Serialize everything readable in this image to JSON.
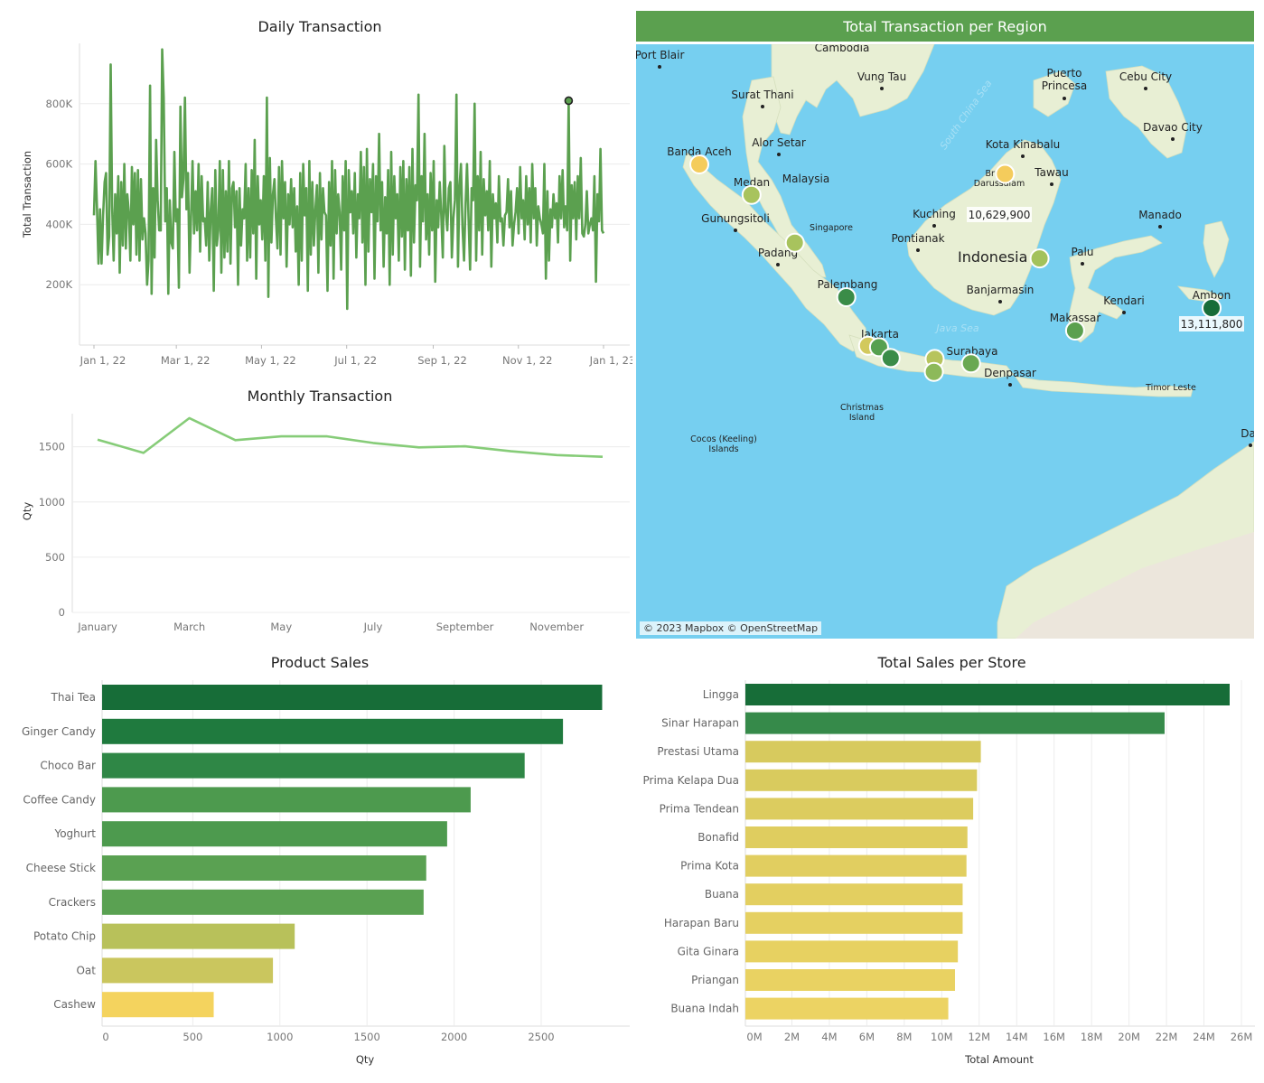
{
  "daily": {
    "title": "Daily Transaction",
    "ylabel": "Total Transaction",
    "xticks": [
      "Jan 1, 22",
      "Mar 1, 22",
      "May 1, 22",
      "Jul 1, 22",
      "Sep 1, 22",
      "Nov 1, 22",
      "Jan 1, 23"
    ],
    "yticks": [
      "200K",
      "400K",
      "600K",
      "800K"
    ]
  },
  "monthly": {
    "title": "Monthly Transaction",
    "ylabel": "Qty",
    "xticks": [
      "January",
      "March",
      "May",
      "July",
      "September",
      "November"
    ],
    "yticks": [
      "0",
      "500",
      "1000",
      "1500"
    ]
  },
  "map": {
    "title": "Total Transaction per Region",
    "attribution": "© 2023 Mapbox © OpenStreetMap",
    "country_label": "Indonesia",
    "places": [
      "Cambodia",
      "Port Blair",
      "Vung Tau",
      "Surat Thani",
      "Puerto Princesa",
      "Cebu City",
      "Davao City",
      "Alor Setar",
      "Banda Aceh",
      "Medan",
      "Malaysia",
      "Kota Kinabalu",
      "Brunei Darussalam",
      "Tawau",
      "Kuching",
      "Gunungsitoli",
      "Singapore",
      "Manado",
      "Padang",
      "Pontianak",
      "Palu",
      "Palembang",
      "Banjarmasin",
      "Kendari",
      "Ambon",
      "Makassar",
      "Jakarta",
      "Surabaya",
      "Denpasar",
      "Christmas Island",
      "Cocos (Keeling) Islands",
      "Timor Leste",
      "Dar",
      "South China Sea",
      "Java Sea"
    ],
    "value_labels": [
      "10,629,900",
      "13,111,800"
    ]
  },
  "product": {
    "title": "Product Sales",
    "xlabel": "Qty",
    "xticks": [
      "0",
      "500",
      "1000",
      "1500",
      "2000",
      "2500"
    ]
  },
  "store": {
    "title": "Total Sales per Store",
    "xlabel": "Total Amount",
    "xticks": [
      "0M",
      "2M",
      "4M",
      "6M",
      "8M",
      "10M",
      "12M",
      "14M",
      "16M",
      "18M",
      "20M",
      "22M",
      "24M",
      "26M"
    ]
  },
  "colors": {
    "dark_green": "#176d38",
    "green": "#5ba04f",
    "light_green": "#86cc78",
    "yellow": "#f4d35e",
    "water": "#76cff0",
    "land": "#e8efd4"
  },
  "chart_data": [
    {
      "type": "line",
      "title": "Daily Transaction",
      "ylabel": "Total Transaction",
      "x_range": [
        "2022-01-01",
        "2022-12-31"
      ],
      "ylim": [
        0,
        1000000
      ],
      "series": [
        {
          "values": [
            430000,
            610000,
            450000,
            270000,
            450000,
            270000,
            430000,
            540000,
            570000,
            300000,
            360000,
            930000,
            460000,
            280000,
            500000,
            370000,
            560000,
            240000,
            540000,
            330000,
            600000,
            320000,
            500000,
            440000,
            280000,
            590000,
            400000,
            570000,
            300000,
            580000,
            280000,
            550000,
            350000,
            420000,
            370000,
            200000,
            280000,
            860000,
            170000,
            520000,
            290000,
            680000,
            480000,
            380000,
            380000,
            980000,
            820000,
            410000,
            520000,
            170000,
            480000,
            340000,
            320000,
            640000,
            410000,
            450000,
            190000,
            790000,
            490000,
            550000,
            820000,
            450000,
            570000,
            240000,
            420000,
            610000,
            370000,
            510000,
            380000,
            600000,
            310000,
            560000,
            410000,
            420000,
            330000,
            540000,
            280000,
            450000,
            520000,
            180000,
            580000,
            330000,
            380000,
            610000,
            240000,
            580000,
            290000,
            510000,
            310000,
            610000,
            270000,
            520000,
            540000,
            390000,
            510000,
            200000,
            520000,
            330000,
            450000,
            420000,
            600000,
            280000,
            520000,
            290000,
            580000,
            370000,
            680000,
            220000,
            560000,
            400000,
            480000,
            350000,
            560000,
            280000,
            820000,
            160000,
            620000,
            340000,
            500000,
            550000,
            420000,
            320000,
            590000,
            300000,
            610000,
            420000,
            540000,
            260000,
            500000,
            400000,
            550000,
            390000,
            520000,
            310000,
            460000,
            200000,
            570000,
            280000,
            600000,
            430000,
            520000,
            180000,
            610000,
            300000,
            540000,
            330000,
            450000,
            530000,
            240000,
            570000,
            350000,
            520000,
            440000,
            430000,
            180000,
            540000,
            330000,
            610000,
            220000,
            580000,
            370000,
            500000,
            440000,
            250000,
            560000,
            380000,
            610000,
            120000,
            580000,
            440000,
            510000,
            370000,
            570000,
            290000,
            500000,
            420000,
            640000,
            340000,
            590000,
            200000,
            650000,
            310000,
            550000,
            440000,
            600000,
            220000,
            560000,
            410000,
            700000,
            380000,
            540000,
            260000,
            490000,
            370000,
            580000,
            200000,
            640000,
            300000,
            560000,
            420000,
            500000,
            280000,
            590000,
            360000,
            610000,
            250000,
            550000,
            380000,
            590000,
            230000,
            650000,
            340000,
            530000,
            480000,
            830000,
            260000,
            560000,
            410000,
            700000,
            350000,
            500000,
            300000,
            570000,
            380000,
            610000,
            210000,
            480000,
            390000,
            540000,
            430000,
            290000,
            660000,
            440000,
            380000,
            520000,
            540000,
            290000,
            420000,
            480000,
            830000,
            260000,
            520000,
            600000,
            390000,
            280000,
            470000,
            600000,
            420000,
            250000,
            520000,
            480000,
            800000,
            280000,
            560000,
            380000,
            640000,
            300000,
            550000,
            430000,
            510000,
            380000,
            610000,
            260000,
            500000,
            420000,
            470000,
            340000,
            560000,
            410000,
            420000,
            330000,
            430000,
            440000,
            550000,
            390000,
            510000,
            330000,
            400000,
            440000,
            520000,
            370000,
            590000,
            420000,
            480000,
            350000,
            560000,
            400000,
            520000,
            340000,
            600000,
            420000,
            520000,
            330000,
            460000,
            420000,
            400000,
            370000,
            600000,
            220000,
            510000,
            280000,
            450000,
            390000,
            500000,
            420000,
            470000,
            340000,
            560000,
            420000,
            580000,
            390000,
            460000,
            380000,
            810000,
            280000,
            530000,
            420000,
            540000,
            350000,
            560000,
            420000,
            620000,
            370000,
            360000,
            400000,
            510000,
            370000,
            400000,
            420000,
            380000,
            560000,
            210000,
            500000,
            410000,
            650000,
            380000,
            370000
          ]
        }
      ]
    },
    {
      "type": "line",
      "title": "Monthly Transaction",
      "ylabel": "Qty",
      "categories": [
        "January",
        "February",
        "March",
        "April",
        "May",
        "June",
        "July",
        "August",
        "September",
        "October",
        "November",
        "December"
      ],
      "ylim": [
        0,
        1800
      ],
      "series": [
        {
          "values": [
            1565,
            1445,
            1760,
            1560,
            1595,
            1595,
            1535,
            1495,
            1505,
            1460,
            1425,
            1410
          ]
        }
      ]
    },
    {
      "type": "bar",
      "orientation": "horizontal",
      "title": "Product Sales",
      "xlabel": "Qty",
      "categories": [
        "Thai Tea",
        "Ginger Candy",
        "Choco Bar",
        "Coffee Candy",
        "Yoghurt",
        "Cheese Stick",
        "Crackers",
        "Potato Chip",
        "Oat",
        "Cashew"
      ],
      "values": [
        2850,
        2625,
        2405,
        2095,
        1960,
        1840,
        1825,
        1085,
        960,
        620
      ],
      "colors": [
        "#176d38",
        "#1f7a3e",
        "#2f8746",
        "#4d9a4e",
        "#4d9a4e",
        "#5aa152",
        "#5aa152",
        "#b8c15a",
        "#cac65e",
        "#f4d35e"
      ],
      "xlim": [
        0,
        3000
      ]
    },
    {
      "type": "bar",
      "orientation": "horizontal",
      "title": "Total Sales per Store",
      "xlabel": "Total Amount",
      "categories": [
        "Lingga",
        "Sinar Harapan",
        "Prestasi Utama",
        "Prima Kelapa Dua",
        "Prima Tendean",
        "Bonafid",
        "Prima Kota",
        "Buana",
        "Harapan Baru",
        "Gita Ginara",
        "Priangan",
        "Buana Indah"
      ],
      "values": [
        25300000,
        21900000,
        12300000,
        12100000,
        11900000,
        11600000,
        11550000,
        11350000,
        11350000,
        11100000,
        10950000,
        10600000
      ],
      "colors": [
        "#176d38",
        "#368a4a",
        "#d7ca5e",
        "#d9cb5e",
        "#dccc5f",
        "#dfcd5f",
        "#e1ce60",
        "#e3cf60",
        "#e5d061",
        "#e7d161",
        "#e9d262",
        "#ecd363"
      ],
      "xlim": [
        0,
        26500000
      ]
    },
    {
      "type": "scatter",
      "title": "Total Transaction per Region",
      "kind": "map",
      "points": [
        {
          "region": "Banda Aceh",
          "lon": 95.32,
          "lat": 5.55,
          "value": 10700000,
          "color": "#f4cc5c"
        },
        {
          "region": "Medan",
          "lon": 98.67,
          "lat": 3.59,
          "value": 11900000,
          "color": "#a8c35d"
        },
        {
          "region": "Pekanbaru",
          "lon": 101.45,
          "lat": 0.51,
          "value": 11800000,
          "color": "#a8c35d"
        },
        {
          "region": "Brunei Darussalam",
          "lon": 114.94,
          "lat": 4.94,
          "value": 10629900,
          "color": "#f4cc5c"
        },
        {
          "region": "Samarinda",
          "lon": 117.15,
          "lat": -0.5,
          "value": 11900000,
          "color": "#a3c25b"
        },
        {
          "region": "Palembang",
          "lon": 104.75,
          "lat": -2.99,
          "value": 12500000,
          "color": "#3a8c48"
        },
        {
          "region": "Ambon",
          "lon": 128.19,
          "lat": -3.69,
          "value": 13111800,
          "color": "#176d38"
        },
        {
          "region": "Makassar",
          "lon": 119.43,
          "lat": -5.14,
          "value": 12200000,
          "color": "#5ba04f"
        },
        {
          "region": "Serang",
          "lon": 106.15,
          "lat": -6.12,
          "value": 11300000,
          "color": "#d2c95d"
        },
        {
          "region": "Jakarta",
          "lon": 106.85,
          "lat": -6.21,
          "value": 12300000,
          "color": "#56a050"
        },
        {
          "region": "Bandung",
          "lon": 107.6,
          "lat": -6.91,
          "value": 12500000,
          "color": "#3a8c48"
        },
        {
          "region": "Semarang",
          "lon": 110.42,
          "lat": -6.97,
          "value": 11500000,
          "color": "#b7c45d"
        },
        {
          "region": "Yogyakarta",
          "lon": 110.37,
          "lat": -7.8,
          "value": 12000000,
          "color": "#8db95a"
        },
        {
          "region": "Surabaya",
          "lon": 112.75,
          "lat": -7.25,
          "value": 12200000,
          "color": "#6aa852"
        }
      ]
    }
  ]
}
